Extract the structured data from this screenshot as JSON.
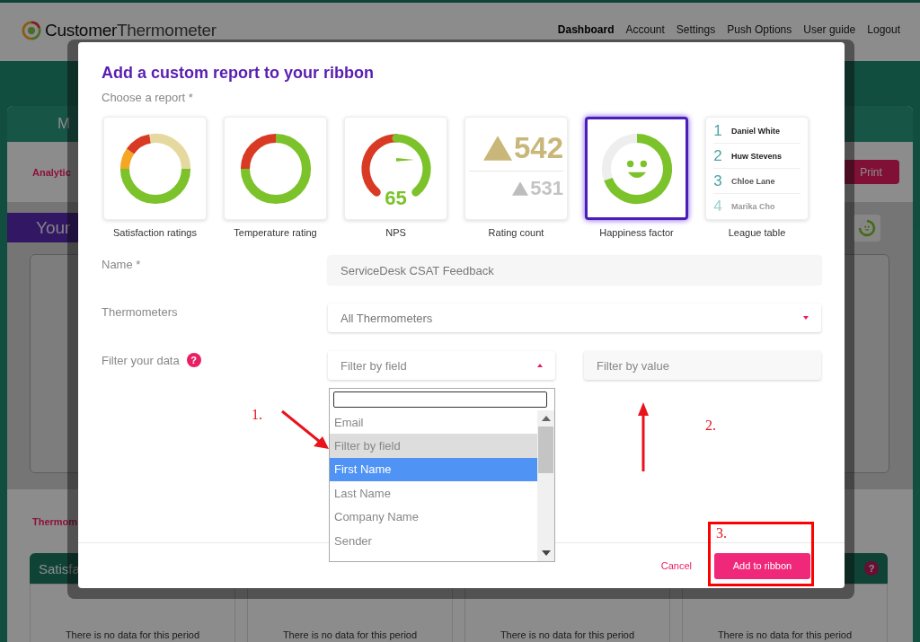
{
  "brand": {
    "first": "Customer",
    "second": "Thermometer"
  },
  "nav": [
    {
      "label": "Dashboard",
      "selected": true
    },
    {
      "label": "Account",
      "selected": false
    },
    {
      "label": "Settings",
      "selected": false
    },
    {
      "label": "Push Options",
      "selected": false
    },
    {
      "label": "User guide",
      "selected": false
    },
    {
      "label": "Logout",
      "selected": false
    }
  ],
  "background": {
    "tab": "M",
    "section_title": "Analytic",
    "print_button": "Print",
    "report_bar": "Your",
    "section2_title": "Thermom",
    "cards": [
      {
        "title": "Satisfa",
        "text": "There is no data for this period"
      },
      {
        "text": "There is no data for this period"
      },
      {
        "text": "There is no data for this period"
      },
      {
        "help": "?",
        "text": "There is no data for this period"
      }
    ]
  },
  "modal": {
    "title": "Add a custom report to your ribbon",
    "subtitle": "Choose a report *",
    "reports": [
      {
        "kind": "satisfaction",
        "label": "Satisfaction ratings",
        "selected": false
      },
      {
        "kind": "temperature",
        "label": "Temperature rating",
        "selected": false
      },
      {
        "kind": "nps",
        "label": "NPS",
        "score": "65",
        "selected": false
      },
      {
        "kind": "count",
        "label": "Rating count",
        "primary": "542",
        "secondary": "531",
        "selected": false
      },
      {
        "kind": "happiness",
        "label": "Happiness factor",
        "selected": true
      },
      {
        "kind": "league",
        "label": "League table",
        "selected": false,
        "entries": [
          {
            "rank": "1",
            "name": "Daniel White"
          },
          {
            "rank": "2",
            "name": "Huw Stevens"
          },
          {
            "rank": "3",
            "name": "Chloe Lane"
          },
          {
            "rank": "4",
            "name": "Marika Cho"
          }
        ]
      }
    ],
    "fields": [
      {
        "kind": "text",
        "label": "Name *",
        "value": "ServiceDesk CSAT Feedback"
      },
      {
        "kind": "select",
        "label": "Thermometers",
        "value": "All Thermometers"
      },
      {
        "kind": "filter",
        "label": "Filter your data",
        "help": "?",
        "field_placeholder": "Filter by field",
        "value_placeholder": "Filter by value"
      }
    ],
    "dropdown": {
      "items": [
        {
          "label": "Email",
          "selected": false,
          "highlighted": false
        },
        {
          "label": "Filter by field",
          "selected": false,
          "highlighted": true
        },
        {
          "label": "First Name",
          "selected": true,
          "highlighted": false
        },
        {
          "label": "Last Name",
          "selected": false,
          "highlighted": false
        },
        {
          "label": "Company Name",
          "selected": false,
          "highlighted": false
        },
        {
          "label": "Sender",
          "selected": false,
          "highlighted": false
        }
      ]
    },
    "cancel": "Cancel",
    "submit": "Add to ribbon"
  },
  "annotations": [
    {
      "kind": "arrow-down-right",
      "label": "1."
    },
    {
      "kind": "arrow-up",
      "label": "2."
    },
    {
      "kind": "box",
      "label": "3."
    }
  ]
}
